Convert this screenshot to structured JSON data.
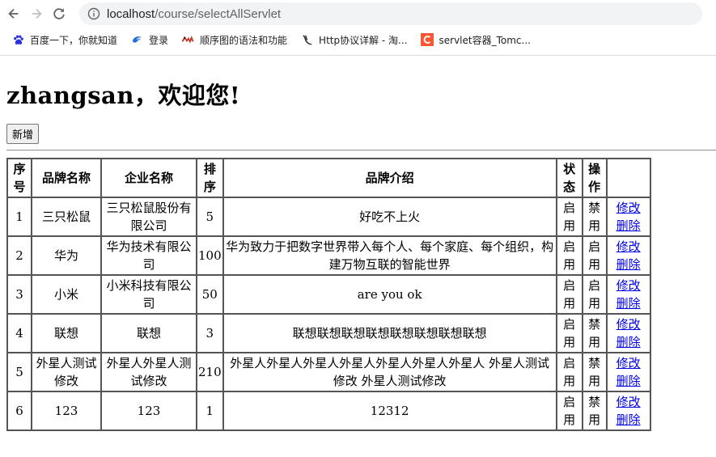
{
  "browser": {
    "url_host": "localhost",
    "url_path": "/course/selectAllServlet",
    "bookmarks": [
      {
        "label": "百度一下，你就知道",
        "icon": "baidu-paw-icon"
      },
      {
        "label": "登录",
        "icon": "login-bird-icon"
      },
      {
        "label": "顺序图的语法和功能",
        "icon": "plantuml-icon"
      },
      {
        "label": "Http协议详解 - 淘...",
        "icon": "http-icon"
      },
      {
        "label": "servlet容器_Tomc...",
        "icon": "csdn-c-icon"
      }
    ]
  },
  "page": {
    "welcome": "zhangsan，欢迎您!",
    "add_button": "新增"
  },
  "table": {
    "headers": [
      "序号",
      "品牌名称",
      "企业名称",
      "排序",
      "品牌介绍",
      "状态",
      "操作"
    ],
    "edit_label": "修改",
    "delete_label": "删除",
    "rows": [
      {
        "id": "1",
        "brand": "三只松鼠",
        "company": "三只松鼠股份有限公司",
        "order": "5",
        "desc": "好吃不上火",
        "status": "启用",
        "op": "禁用"
      },
      {
        "id": "2",
        "brand": "华为",
        "company": "华为技术有限公司",
        "order": "100",
        "desc": "华为致力于把数字世界带入每个人、每个家庭、每个组织，构建万物互联的智能世界",
        "status": "启用",
        "op": "启用"
      },
      {
        "id": "3",
        "brand": "小米",
        "company": "小米科技有限公司",
        "order": "50",
        "desc": "are you ok",
        "status": "启用",
        "op": "启用"
      },
      {
        "id": "4",
        "brand": "联想",
        "company": "联想",
        "order": "3",
        "desc": "联想联想联想联想联想联想联想联想",
        "status": "启用",
        "op": "禁用"
      },
      {
        "id": "5",
        "brand": "外星人测试修改",
        "company": "外星人外星人测试修改",
        "order": "210",
        "desc": "外星人外星人外星人外星人外星人外星人外星人 外星人测试修改 外星人测试修改",
        "status": "启用",
        "op": "禁用"
      },
      {
        "id": "6",
        "brand": "123",
        "company": "123",
        "order": "1",
        "desc": "12312",
        "status": "启用",
        "op": "禁用"
      }
    ]
  }
}
